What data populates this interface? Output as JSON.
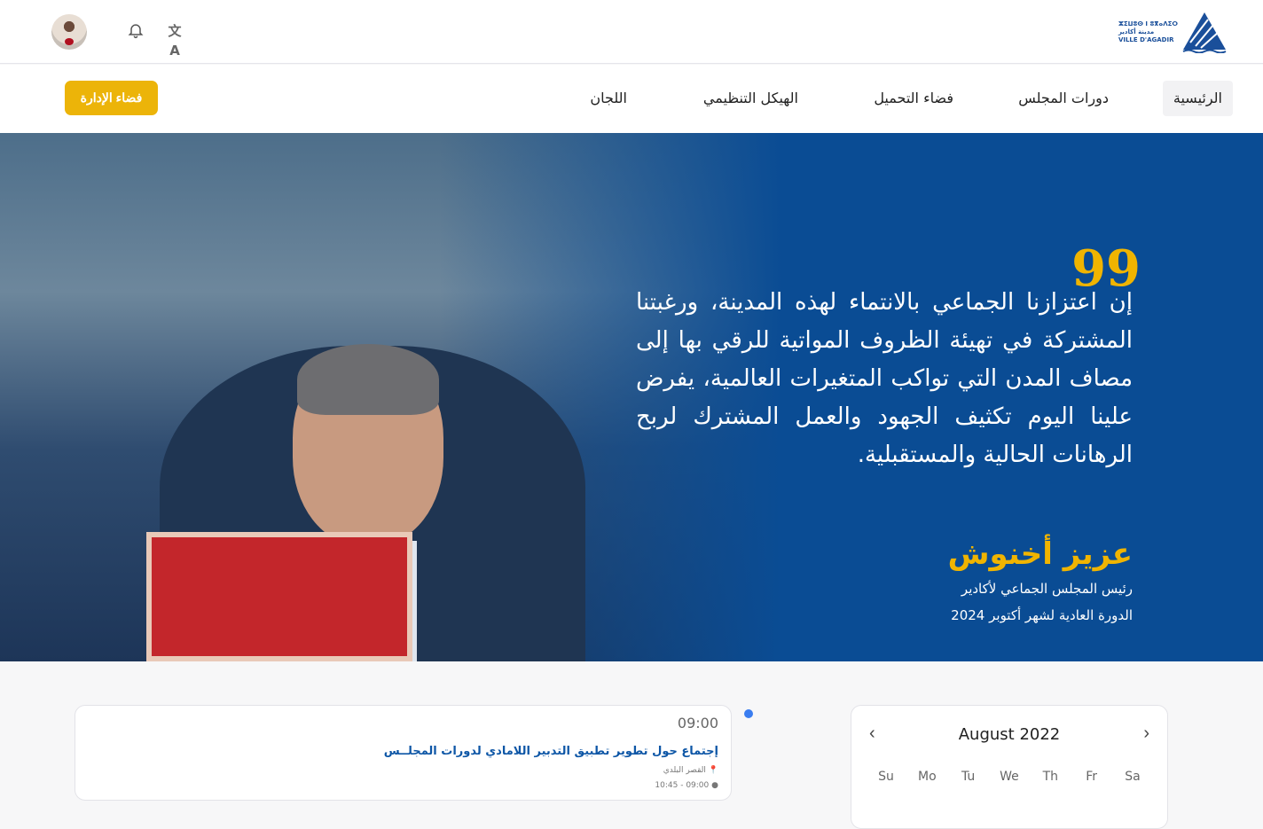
{
  "header": {
    "logo_lines": [
      "ⵣⵉⵡⵓⵙ ⵏ ⵓⴳⴰⴷⵉⵔ",
      "مدينة أكادير",
      "VILLE D'AGADIR"
    ],
    "icons": [
      "avatar",
      "bell-icon",
      "translate-icon"
    ]
  },
  "nav": {
    "items": [
      "الرئيسية",
      "دورات المجلس",
      "فضاء التحميل",
      "الهيكل التنظيمي",
      "اللجان"
    ],
    "admin_button": "فضاء الإدارة"
  },
  "hero": {
    "quote_mark": "99",
    "quote": "إن اعتزازنا الجماعي بالانتماء لهذه المدينة، ورغبتنا المشتركة في تهيئة الظروف المواتية للرقي بها إلى مصاف المدن التي تواكب المتغيرات العالمية، يفرض علينا اليوم تكثيف الجهود والعمل المشترك لربح الرهانات الحالية والمستقبلية.",
    "author": "عزيز أخنوش",
    "role": "رئيس المجلس الجماعي لأكادير",
    "session": "الدورة العادية لشهر أكتوبر 2024"
  },
  "event": {
    "time": "09:00",
    "title": "إجتماع حول تطوير تطبيق التدبير اللامادي لدورات المجلــس",
    "location": "القصر البلدي",
    "range": "10:45 - 09:00"
  },
  "calendar": {
    "title": "August 2022",
    "prev": "‹",
    "next": "›",
    "days": [
      "Su",
      "Mo",
      "Tu",
      "We",
      "Th",
      "Fr",
      "Sa"
    ]
  },
  "colors": {
    "primary": "#0a4c94",
    "accent": "#ecb409"
  }
}
